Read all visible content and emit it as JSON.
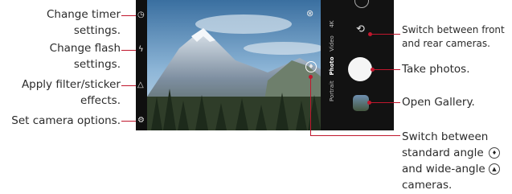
{
  "callouts": {
    "timer": "Change timer\nsettings.",
    "flash": "Change flash\nsettings.",
    "filter": "Apply filter/sticker\neffects.",
    "options": "Set camera options.",
    "switch_camera": "Switch between front\nand rear cameras.",
    "take_photos": "Take photos.",
    "gallery": "Open Gallery.",
    "angle_line1": "Switch between",
    "angle_line2": "standard angle",
    "angle_line3": "and wide-angle",
    "angle_line4": "cameras."
  },
  "modes": [
    "Portrait",
    "Photo",
    "Video",
    "4K"
  ],
  "active_mode": "Photo",
  "colors": {
    "accent": "#c0172d"
  }
}
